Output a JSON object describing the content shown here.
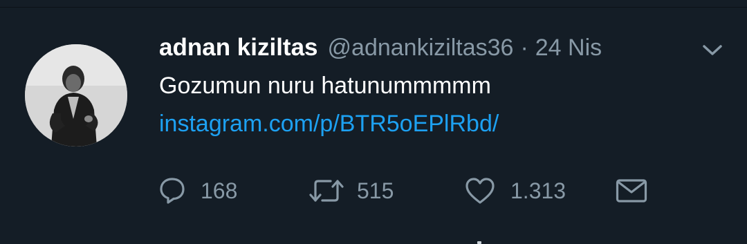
{
  "tweet": {
    "author_name": "adnan kiziltas",
    "handle": "@adnankiziltas36",
    "separator": "·",
    "date": "24 Nis",
    "text": "Gozumun nuru hatunummmmm",
    "link": "instagram.com/p/BTR5oEPlRbd/",
    "link_color": "#1da1f2"
  },
  "actions": {
    "reply_count": "168",
    "retweet_count": "515",
    "like_count": "1.313"
  },
  "icons": {
    "menu": "chevron-down-icon",
    "reply": "speech-bubble-icon",
    "retweet": "retweet-arrows-icon",
    "like": "heart-icon",
    "dm": "envelope-icon"
  },
  "colors": {
    "background": "#141d26",
    "secondary_text": "#8899a6",
    "primary_text": "#ffffff"
  }
}
